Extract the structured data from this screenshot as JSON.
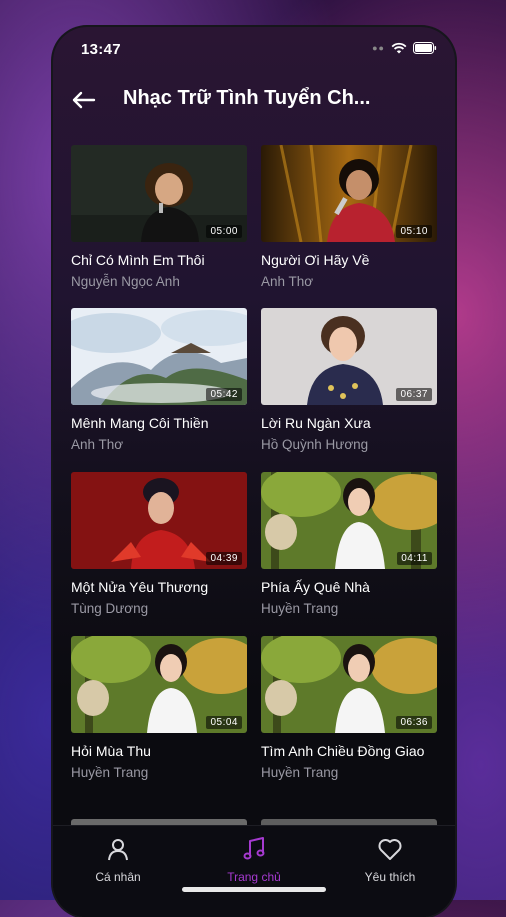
{
  "status_bar": {
    "time": "13:47"
  },
  "header": {
    "title": "Nhạc Trữ Tình Tuyển Ch...",
    "back_icon": "arrow-left-icon"
  },
  "videos": [
    {
      "title": "Chỉ Có Mình Em Thôi",
      "artist": "Nguyễn Ngọc Anh",
      "duration": "05:00"
    },
    {
      "title": "Người Ơi Hãy Về",
      "artist": "Anh Thơ",
      "duration": "05:10"
    },
    {
      "title": "Mênh Mang Côi Thiền",
      "artist": "Anh Thơ",
      "duration": "05:42"
    },
    {
      "title": "Lời Ru Ngàn Xưa",
      "artist": "Hồ Quỳnh Hương",
      "duration": "06:37"
    },
    {
      "title": "Một Nửa Yêu Thương",
      "artist": "Tùng Dương",
      "duration": "04:39"
    },
    {
      "title": "Phía Ấy Quê Nhà",
      "artist": "Huyền Trang",
      "duration": "04:11"
    },
    {
      "title": "Hỏi Mùa Thu",
      "artist": "Huyền Trang",
      "duration": "05:04"
    },
    {
      "title": "Tìm Anh Chiều Đồng Giao",
      "artist": "Huyền Trang",
      "duration": "06:36"
    }
  ],
  "tabs": [
    {
      "label": "Cá nhân",
      "icon": "person-icon",
      "active": false
    },
    {
      "label": "Trang chủ",
      "icon": "music-note-icon",
      "active": true
    },
    {
      "label": "Yêu thích",
      "icon": "heart-icon",
      "active": false
    }
  ],
  "colors": {
    "accent": "#a63ad0",
    "inactive_tab": "#d8d8dc",
    "secondary_text": "#9a99a4"
  }
}
